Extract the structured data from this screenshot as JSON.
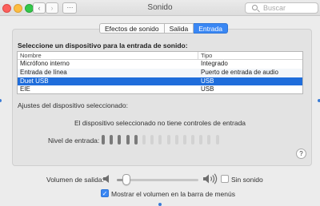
{
  "window": {
    "title": "Sonido"
  },
  "toolbar": {
    "back_glyph": "‹",
    "forward_glyph": "›",
    "grid_glyph": "⋯",
    "search_placeholder": "Buscar"
  },
  "tabs": [
    {
      "label": "Efectos de sonido",
      "active": false
    },
    {
      "label": "Salida",
      "active": false
    },
    {
      "label": "Entrada",
      "active": true
    }
  ],
  "input": {
    "select_label": "Seleccione un dispositivo para la entrada de sonido:",
    "columns": {
      "name": "Nombre",
      "type": "Tipo"
    },
    "devices": [
      {
        "name": "Micrófono interno",
        "type": "Integrado"
      },
      {
        "name": "Entrada de línea",
        "type": "Puerto de entrada de audio"
      },
      {
        "name": "Duet USB",
        "type": "USB",
        "selected": true
      },
      {
        "name": "EIE",
        "type": "USB"
      }
    ],
    "settings_label": "Ajustes del dispositivo seleccionado:",
    "no_controls_text": "El dispositivo seleccionado no tiene controles de entrada",
    "level_label": "Nivel de entrada:",
    "level_segments_total": 15,
    "level_segments_lit": 5
  },
  "help": {
    "glyph": "?"
  },
  "output": {
    "volume_label": "Volumen de salida:",
    "volume_level": 0.12,
    "mute_label": "Sin sonido",
    "mute_checked": false,
    "menubar_label": "Mostrar el volumen en la barra de menús",
    "menubar_checked": true,
    "check_glyph": "✓"
  },
  "colors": {
    "accent": "#3a87f4",
    "selection": "#1f6ddb",
    "meter_on": "#7a7a7a",
    "meter_off": "#d2d2d2"
  }
}
